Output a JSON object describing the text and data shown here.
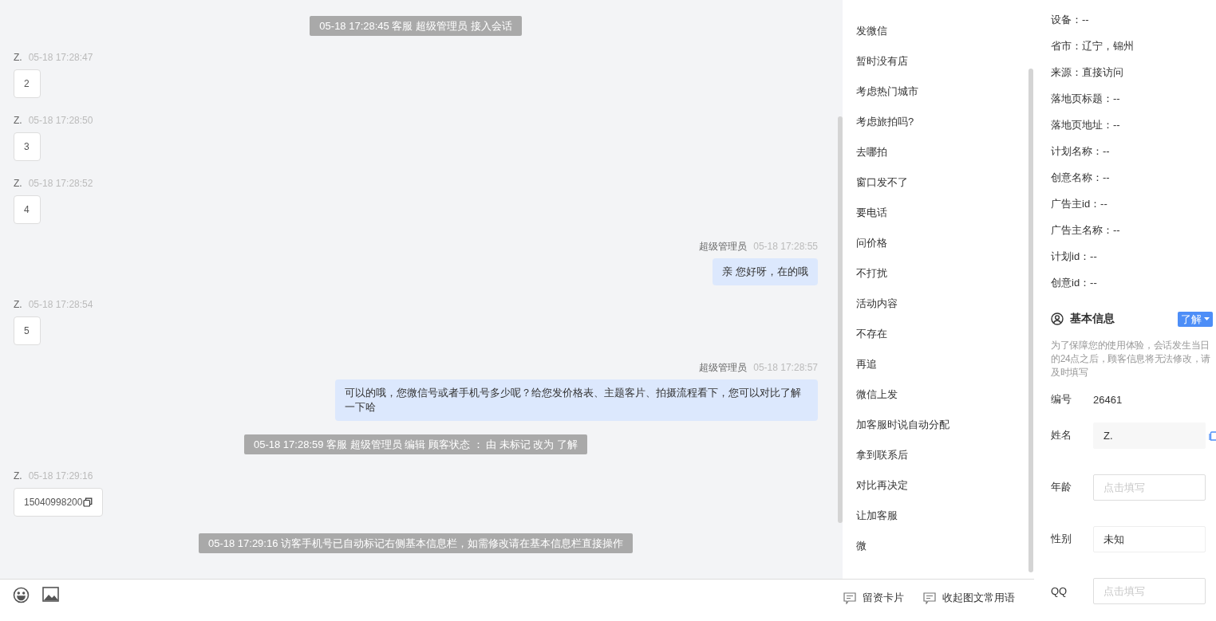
{
  "chat": {
    "messages": [
      {
        "kind": "system",
        "text": "05-18 17:28:45 客服 超级管理员 接入会话"
      },
      {
        "kind": "visitor",
        "sender": "Z.",
        "time": "05-18 17:28:47",
        "text": "2",
        "copyable": false
      },
      {
        "kind": "visitor",
        "sender": "Z.",
        "time": "05-18 17:28:50",
        "text": "3",
        "copyable": false
      },
      {
        "kind": "visitor",
        "sender": "Z.",
        "time": "05-18 17:28:52",
        "text": "4",
        "copyable": false
      },
      {
        "kind": "agent",
        "sender": "超级管理员",
        "time": "05-18 17:28:55",
        "text": "亲 您好呀，在的哦"
      },
      {
        "kind": "visitor",
        "sender": "Z.",
        "time": "05-18 17:28:54",
        "text": "5",
        "copyable": false
      },
      {
        "kind": "agent",
        "sender": "超级管理员",
        "time": "05-18 17:28:57",
        "text": "可以的哦，您微信号或者手机号多少呢？给您发价格表、主题客片、拍摄流程看下，您可以对比了解一下哈"
      },
      {
        "kind": "system",
        "text": "05-18 17:28:59 客服 超级管理员 编辑 顾客状态 ： 由 未标记 改为 了解"
      },
      {
        "kind": "visitor",
        "sender": "Z.",
        "time": "05-18 17:29:16",
        "text": "15040998200",
        "copyable": true
      },
      {
        "kind": "system",
        "text": "05-18 17:29:16 访客手机号已自动标记右侧基本信息栏，如需修改请在基本信息栏直接操作"
      }
    ]
  },
  "quick_replies": [
    "发微信",
    "暂时没有店",
    "考虑热门城市",
    "考虑旅拍吗?",
    "去哪拍",
    "窗口发不了",
    "要电话",
    "问价格",
    "不打扰",
    "活动内容",
    "不存在",
    "再追",
    "微信上发",
    "加客服时说自动分配",
    "拿到联系后",
    "对比再决定",
    "让加客服",
    "微"
  ],
  "composer": {
    "actions": [
      "留资卡片",
      "收起图文常用语"
    ]
  },
  "visitor_details": [
    "设备：--",
    "省市：辽宁，锦州",
    "来源：直接访问",
    "落地页标题：--",
    "落地页地址：--",
    "计划名称：--",
    "创意名称：--",
    "广告主id：--",
    "广告主名称：--",
    "计划id：--",
    "创意id：--"
  ],
  "basic_info": {
    "title": "基本信息",
    "status": "了解",
    "note": "为了保障您的使用体验，会话发生当日的24点之后，顾客信息将无法修改，请及时填写",
    "fields": [
      {
        "kind": "text",
        "label": "编号",
        "value": "26461"
      },
      {
        "kind": "readonly",
        "label": "姓名",
        "value": "Z."
      },
      {
        "kind": "input",
        "label": "年龄",
        "placeholder": "点击填写"
      },
      {
        "kind": "select",
        "label": "性别",
        "value": "未知"
      },
      {
        "kind": "input",
        "label": "QQ",
        "placeholder": "点击填写"
      }
    ]
  }
}
